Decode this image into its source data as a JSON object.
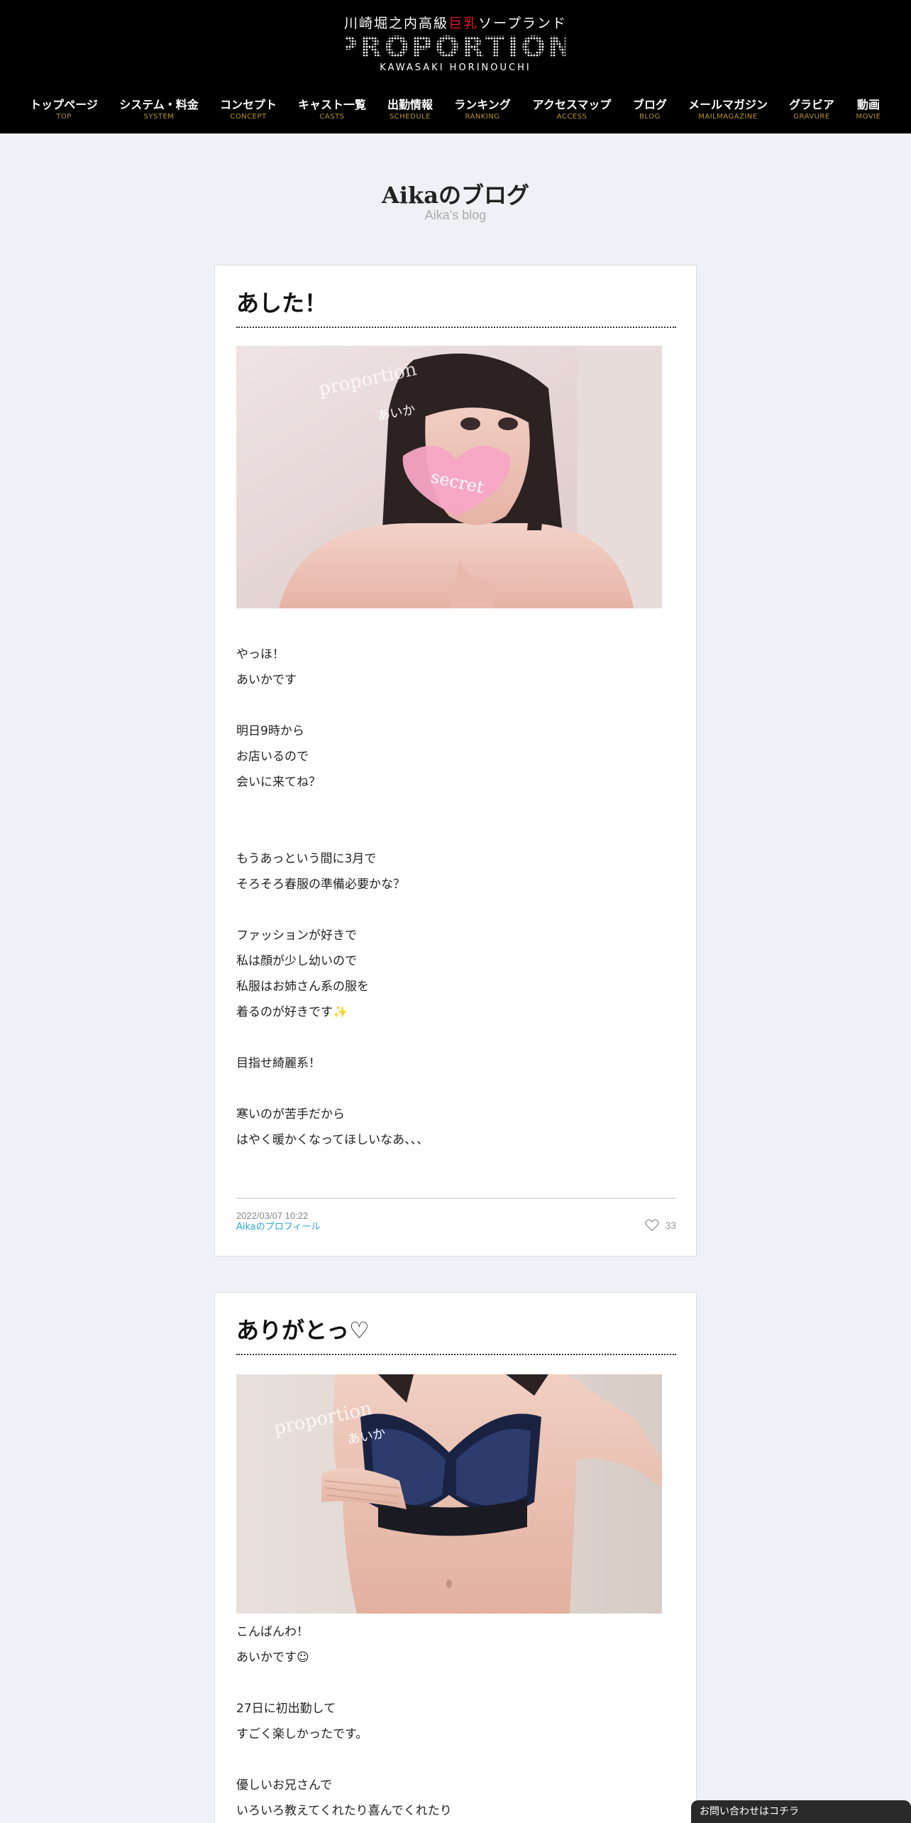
{
  "header": {
    "tagline_before": "川崎堀之内高級",
    "tagline_red": "巨乳",
    "tagline_after": "ソープランド",
    "logo_text": "PROPORTION",
    "logo_sub": "KAWASAKI HORINOUCHI"
  },
  "nav": [
    {
      "jp": "トップページ",
      "en": "TOP"
    },
    {
      "jp": "システム・料金",
      "en": "SYSTEM"
    },
    {
      "jp": "コンセプト",
      "en": "CONCEPT"
    },
    {
      "jp": "キャスト一覧",
      "en": "CASTS"
    },
    {
      "jp": "出勤情報",
      "en": "SCHEDULE"
    },
    {
      "jp": "ランキング",
      "en": "RANKING"
    },
    {
      "jp": "アクセスマップ",
      "en": "ACCESS"
    },
    {
      "jp": "ブログ",
      "en": "BLOG"
    },
    {
      "jp": "メールマガジン",
      "en": "MAILMAGAZINE"
    },
    {
      "jp": "グラビア",
      "en": "GRAVURE"
    },
    {
      "jp": "動画",
      "en": "MOVIE"
    }
  ],
  "page": {
    "title": "Aikaのブログ",
    "subtitle": "Aika's blog"
  },
  "posts": [
    {
      "title": "あした！",
      "image_watermark": "proportion",
      "image_name": "あいか",
      "image_sticker": "secret",
      "lines": [
        "やっほ！",
        "あいかです",
        "",
        "明日9時から",
        "お店いるので",
        "会いに来てね？",
        "",
        "",
        "もうあっという間に3月で",
        "そろそろ春服の準備必要かな？",
        "",
        "ファッションが好きで",
        "私は顔が少し幼いので",
        "私服はお姉さん系の服を",
        "着るのが好きです✨",
        "",
        "目指せ綺麗系！",
        "",
        "寒いのが苦手だから",
        "はやく暖かくなってほしいなあ、、、"
      ],
      "date": "2022/03/07 10:22",
      "profile_link": "Aikaのプロフィール",
      "likes": "33"
    },
    {
      "title": "ありがとっ♡",
      "image_watermark": "proportion",
      "image_name": "あいか",
      "lines": [
        "こんばんわ！",
        "あいかです☺",
        "",
        "27日に初出勤して",
        "すごく楽しかったです。",
        "",
        "優しいお兄さんで",
        "いろいろ教えてくれたり喜んでくれたり"
      ]
    }
  ],
  "contact_tab": "お問い合わせはコチラ",
  "colors": {
    "header_bg": "#000000",
    "accent_red": "#e2131f",
    "nav_en_gold": "#b8962e",
    "link_blue": "#2aa6d9",
    "page_bg": "#f0f1f6"
  }
}
